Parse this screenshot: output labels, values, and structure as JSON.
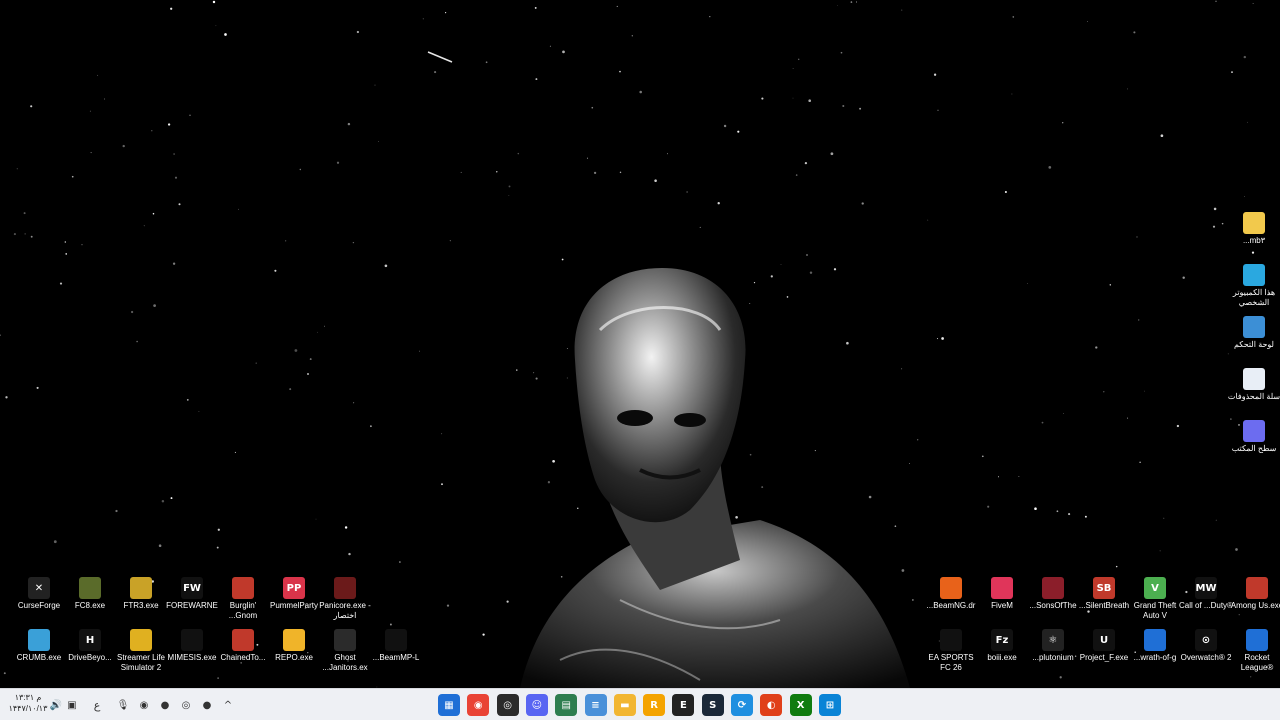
{
  "desktop": {
    "right_column": [
      {
        "label": "...mb۳",
        "icon": "folder-icon",
        "color": "#f2c94c"
      },
      {
        "label": "هذا الكمبيوتر الشخصي",
        "icon": "this-pc-icon",
        "color": "#2aa8e0"
      },
      {
        "label": "لوحة التحكم",
        "icon": "control-panel-icon",
        "color": "#3c8fd6"
      },
      {
        "label": "سلة المحذوفات",
        "icon": "recycle-bin-icon",
        "color": "#e8eef6"
      },
      {
        "label": "سطح المكتب",
        "icon": "desktop-shortcut-icon",
        "color": "#6c6cf0"
      }
    ],
    "bottom_left_row1": [
      {
        "label": "CurseForge",
        "icon": "curseforge-icon",
        "color": "#222222",
        "glyph": "✕"
      },
      {
        "label": "FC8.exe",
        "icon": "fc8-icon",
        "color": "#5a6b2a",
        "glyph": ""
      },
      {
        "label": "FTR3.exe",
        "icon": "ftr3-icon",
        "color": "#c9a227",
        "glyph": ""
      },
      {
        "label": "FOREWARNE",
        "icon": "forewarned-icon",
        "color": "#111111",
        "glyph": "FW"
      },
      {
        "label": "Burglin' ...Gnom",
        "icon": "burglin-gnomes-icon",
        "color": "#c0392b",
        "glyph": ""
      },
      {
        "label": "PummelParty",
        "icon": "pummel-party-icon",
        "color": "#d9344a",
        "glyph": "PP"
      },
      {
        "label": "Panicore.exe - اختصار",
        "icon": "panicore-icon",
        "color": "#6b1a1a",
        "glyph": ""
      }
    ],
    "bottom_left_row2": [
      {
        "label": "CRUMB.exe",
        "icon": "crumb-icon",
        "color": "#3aa0d8",
        "glyph": ""
      },
      {
        "label": "DriveBeyo...",
        "icon": "drive-beyond-icon",
        "color": "#111111",
        "glyph": "H"
      },
      {
        "label": "Streamer Life Simulator 2",
        "icon": "streamer-life-icon",
        "color": "#e0b020",
        "glyph": ""
      },
      {
        "label": "MIMESIS.exe",
        "icon": "mimesis-icon",
        "color": "#111111",
        "glyph": ""
      },
      {
        "label": "ChainedTo...",
        "icon": "chained-together-icon",
        "color": "#c0392b",
        "glyph": ""
      },
      {
        "label": "REPO.exe",
        "icon": "repo-icon",
        "color": "#f0b429",
        "glyph": ""
      },
      {
        "label": "Ghost ...Janitors.ex",
        "icon": "ghost-janitors-icon",
        "color": "#2b2b2b",
        "glyph": ""
      },
      {
        "label": "...BeamMP-L",
        "icon": "beammp-launcher-icon",
        "color": "#111111",
        "glyph": ""
      }
    ],
    "bottom_right_row1": [
      {
        "label": "...BeamNG.dr",
        "icon": "beamng-icon",
        "color": "#e8621a",
        "glyph": ""
      },
      {
        "label": "FiveM",
        "icon": "fivem-icon",
        "color": "#e0355a",
        "glyph": ""
      },
      {
        "label": "...SonsOfThe",
        "icon": "sons-of-the-forest-icon",
        "color": "#8b1e2a",
        "glyph": ""
      },
      {
        "label": "...SilentBreath",
        "icon": "silent-breath-icon",
        "color": "#c0392b",
        "glyph": "SB"
      },
      {
        "label": "Grand Theft Auto V",
        "icon": "gta-v-icon",
        "color": "#4caf50",
        "glyph": "V"
      },
      {
        "label": "Call of ...Duty®",
        "icon": "call-of-duty-icon",
        "color": "#111111",
        "glyph": "MW"
      },
      {
        "label": "Among Us.exe",
        "icon": "among-us-icon",
        "color": "#c0392b",
        "glyph": ""
      }
    ],
    "bottom_right_row2": [
      {
        "label": "EA SPORTS FC 26",
        "icon": "ea-sports-fc-icon",
        "color": "#111111",
        "glyph": ""
      },
      {
        "label": "boiii.exe",
        "icon": "boiii-icon",
        "color": "#111111",
        "glyph": "Fz"
      },
      {
        "label": "...plutonium",
        "icon": "plutonium-icon",
        "color": "#222222",
        "glyph": "⚛"
      },
      {
        "label": "Project_F.exe",
        "icon": "unreal-project-icon",
        "color": "#111111",
        "glyph": "U"
      },
      {
        "label": "...wrath-of-g",
        "icon": "wrath-of-gods-icon",
        "color": "#1f6fd6",
        "glyph": ""
      },
      {
        "label": "Overwatch® 2",
        "icon": "overwatch-icon",
        "color": "#111111",
        "glyph": "⊙"
      },
      {
        "label": "Rocket League®",
        "icon": "rocket-league-icon",
        "color": "#1f6fd6",
        "glyph": ""
      }
    ]
  },
  "taskbar": {
    "clock_time": "۱۳:۳۱ م",
    "clock_date": "۱۴۴۷/۱۰/۱۳",
    "language": "ع",
    "tray": [
      {
        "icon": "volume-icon",
        "glyph": "🔊"
      },
      {
        "icon": "network-icon",
        "glyph": "▣"
      },
      {
        "icon": "microphone-icon",
        "glyph": "🎙"
      },
      {
        "icon": "shield-app-icon",
        "glyph": "◉"
      },
      {
        "icon": "circle-app-icon",
        "glyph": "●"
      },
      {
        "icon": "obs-tray-icon",
        "glyph": "◎"
      },
      {
        "icon": "record-tray-icon",
        "glyph": "●"
      },
      {
        "icon": "chevron-up-icon",
        "glyph": "^"
      }
    ],
    "apps": [
      {
        "name": "store",
        "icon": "microsoft-store-icon",
        "color": "#1f6fd6",
        "glyph": "▦"
      },
      {
        "name": "chrome",
        "icon": "chrome-icon",
        "color": "#e94335",
        "glyph": "◉"
      },
      {
        "name": "obs",
        "icon": "obs-icon",
        "color": "#2b2b2b",
        "glyph": "◎"
      },
      {
        "name": "discord",
        "icon": "discord-icon",
        "color": "#5865f2",
        "glyph": "☺"
      },
      {
        "name": "task-manager",
        "icon": "task-manager-icon",
        "color": "#2e7d4f",
        "glyph": "▤"
      },
      {
        "name": "notepad",
        "icon": "notepad-icon",
        "color": "#4a90d9",
        "glyph": "≡"
      },
      {
        "name": "file-explorer",
        "icon": "file-explorer-icon",
        "color": "#f2b632",
        "glyph": "▬"
      },
      {
        "name": "rockstar",
        "icon": "rockstar-icon",
        "color": "#f4a300",
        "glyph": "R"
      },
      {
        "name": "epic",
        "icon": "epic-games-icon",
        "color": "#222222",
        "glyph": "E"
      },
      {
        "name": "steam",
        "icon": "steam-icon",
        "color": "#1b2838",
        "glyph": "S"
      },
      {
        "name": "edge-like",
        "icon": "browser-icon",
        "color": "#1f8fe0",
        "glyph": "⟳"
      },
      {
        "name": "red-app",
        "icon": "ea-app-icon",
        "color": "#e0401a",
        "glyph": "◐"
      },
      {
        "name": "xbox",
        "icon": "xbox-icon",
        "color": "#107c10",
        "glyph": "X"
      },
      {
        "name": "start",
        "icon": "windows-start-icon",
        "color": "#0a84d6",
        "glyph": "⊞"
      }
    ]
  }
}
